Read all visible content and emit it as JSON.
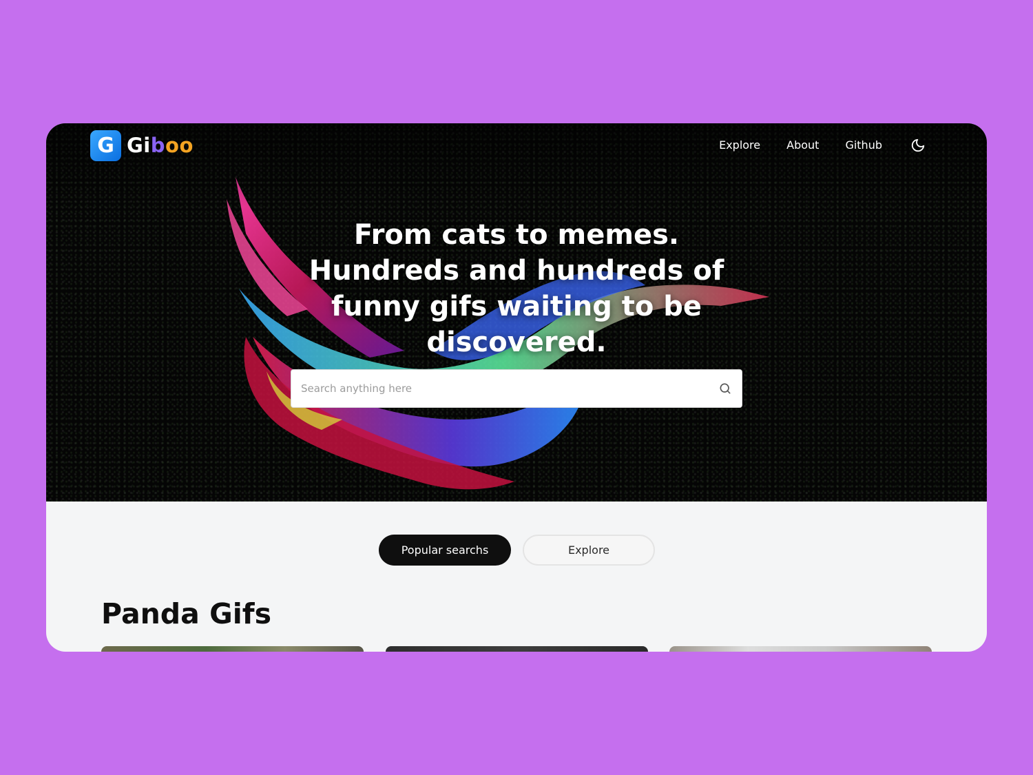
{
  "brand": {
    "logo_letter": "G",
    "name_part1": "Gi",
    "name_part2": "b",
    "name_part3": "oo"
  },
  "nav": {
    "links": [
      "Explore",
      "About",
      "Github"
    ],
    "theme_toggle_icon": "moon-icon"
  },
  "hero": {
    "headline": "From cats to memes. Hundreds and hundreds of funny gifs waiting to be discovered."
  },
  "search": {
    "placeholder": "Search anything here",
    "value": "",
    "icon": "search-icon"
  },
  "tabs": [
    {
      "label": "Popular searchs",
      "active": true
    },
    {
      "label": "Explore",
      "active": false
    }
  ],
  "section": {
    "title": "Panda Gifs"
  },
  "colors": {
    "page_background": "#c56fee",
    "hero_background": "#050505",
    "content_background": "#f4f5f6",
    "logo_blue": "#0a6fe0",
    "logo_purple": "#8a63f3",
    "logo_orange": "#f4a322",
    "active_tab": "#0f0f0f"
  }
}
